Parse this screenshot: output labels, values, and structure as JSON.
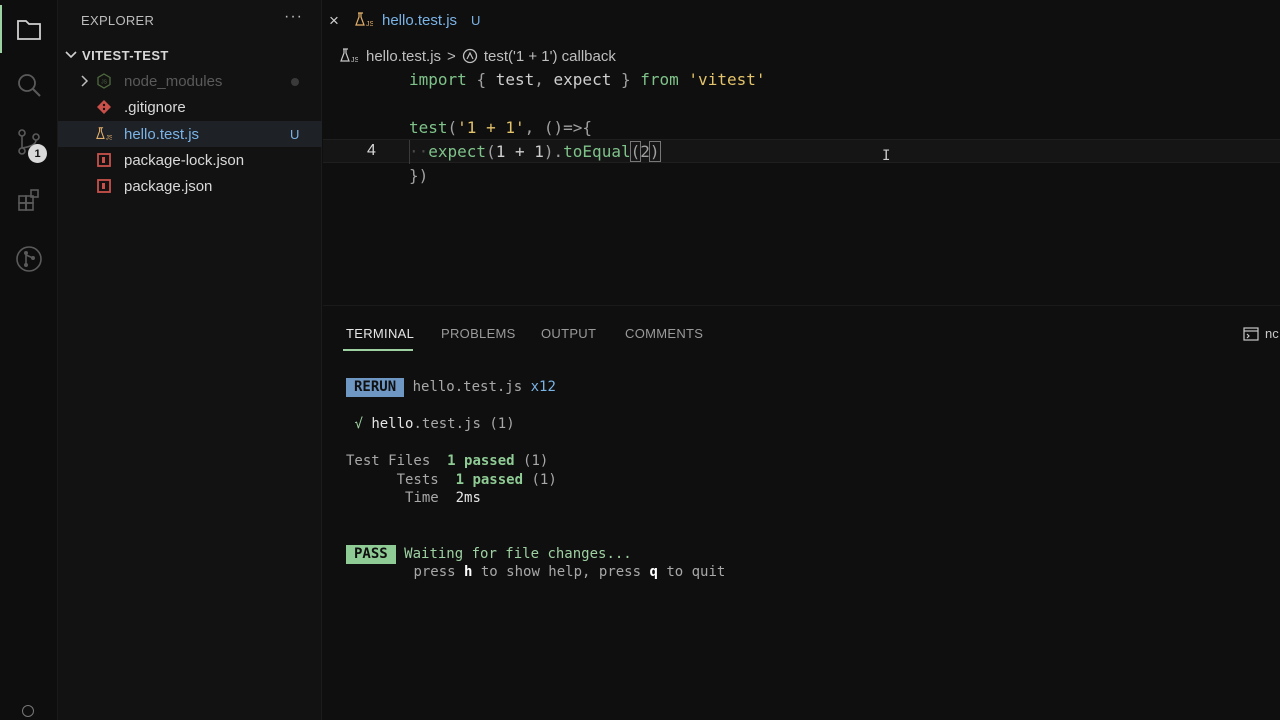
{
  "sidebar": {
    "header": "EXPLORER",
    "more": "···",
    "folder": "VITEST-TEST",
    "items": [
      {
        "label": "node_modules"
      },
      {
        "label": ".gitignore"
      },
      {
        "label": "hello.test.js",
        "status": "U"
      },
      {
        "label": "package-lock.json"
      },
      {
        "label": "package.json"
      }
    ]
  },
  "activity": {
    "scm_badge": "1"
  },
  "tab": {
    "label": "hello.test.js",
    "status": "U",
    "close": "×"
  },
  "breadcrumb": {
    "file": "hello.test.js",
    "sep": ">",
    "symbol": "test('1 + 1') callback"
  },
  "editor": {
    "line_number": "4",
    "lines": [
      "import { test, expect } from 'vitest'",
      "",
      "test('1 + 1', ()=>{",
      "expect(1 + 1).toEqual(2)",
      "})"
    ]
  },
  "panel": {
    "tabs": [
      "TERMINAL",
      "PROBLEMS",
      "OUTPUT",
      "COMMENTS"
    ],
    "right_label": "nc"
  },
  "terminal": {
    "rerun_badge": "RERUN",
    "rerun_file": "hello.test.js",
    "rerun_count": "x12",
    "check": "√",
    "result_file_bold": "hello",
    "result_file_rest": ".test.js",
    "result_count": "(1)",
    "files_label": "Test Files",
    "files_passed": "1 passed",
    "files_count": "(1)",
    "tests_label": "Tests",
    "tests_passed": "1 passed",
    "tests_count": "(1)",
    "time_label": "Time",
    "time_value": "2ms",
    "pass_badge": "PASS",
    "waiting": "Waiting for file changes...",
    "help_pre": "press ",
    "help_key1": "h",
    "help_mid": " to show help, press ",
    "help_key2": "q",
    "help_post": " to quit"
  },
  "colors": {
    "accent_green": "#9ed1a2",
    "accent_blue": "#7ab3e6",
    "rerun_bg": "#6f97c4",
    "pass_bg": "#8fcb94"
  }
}
